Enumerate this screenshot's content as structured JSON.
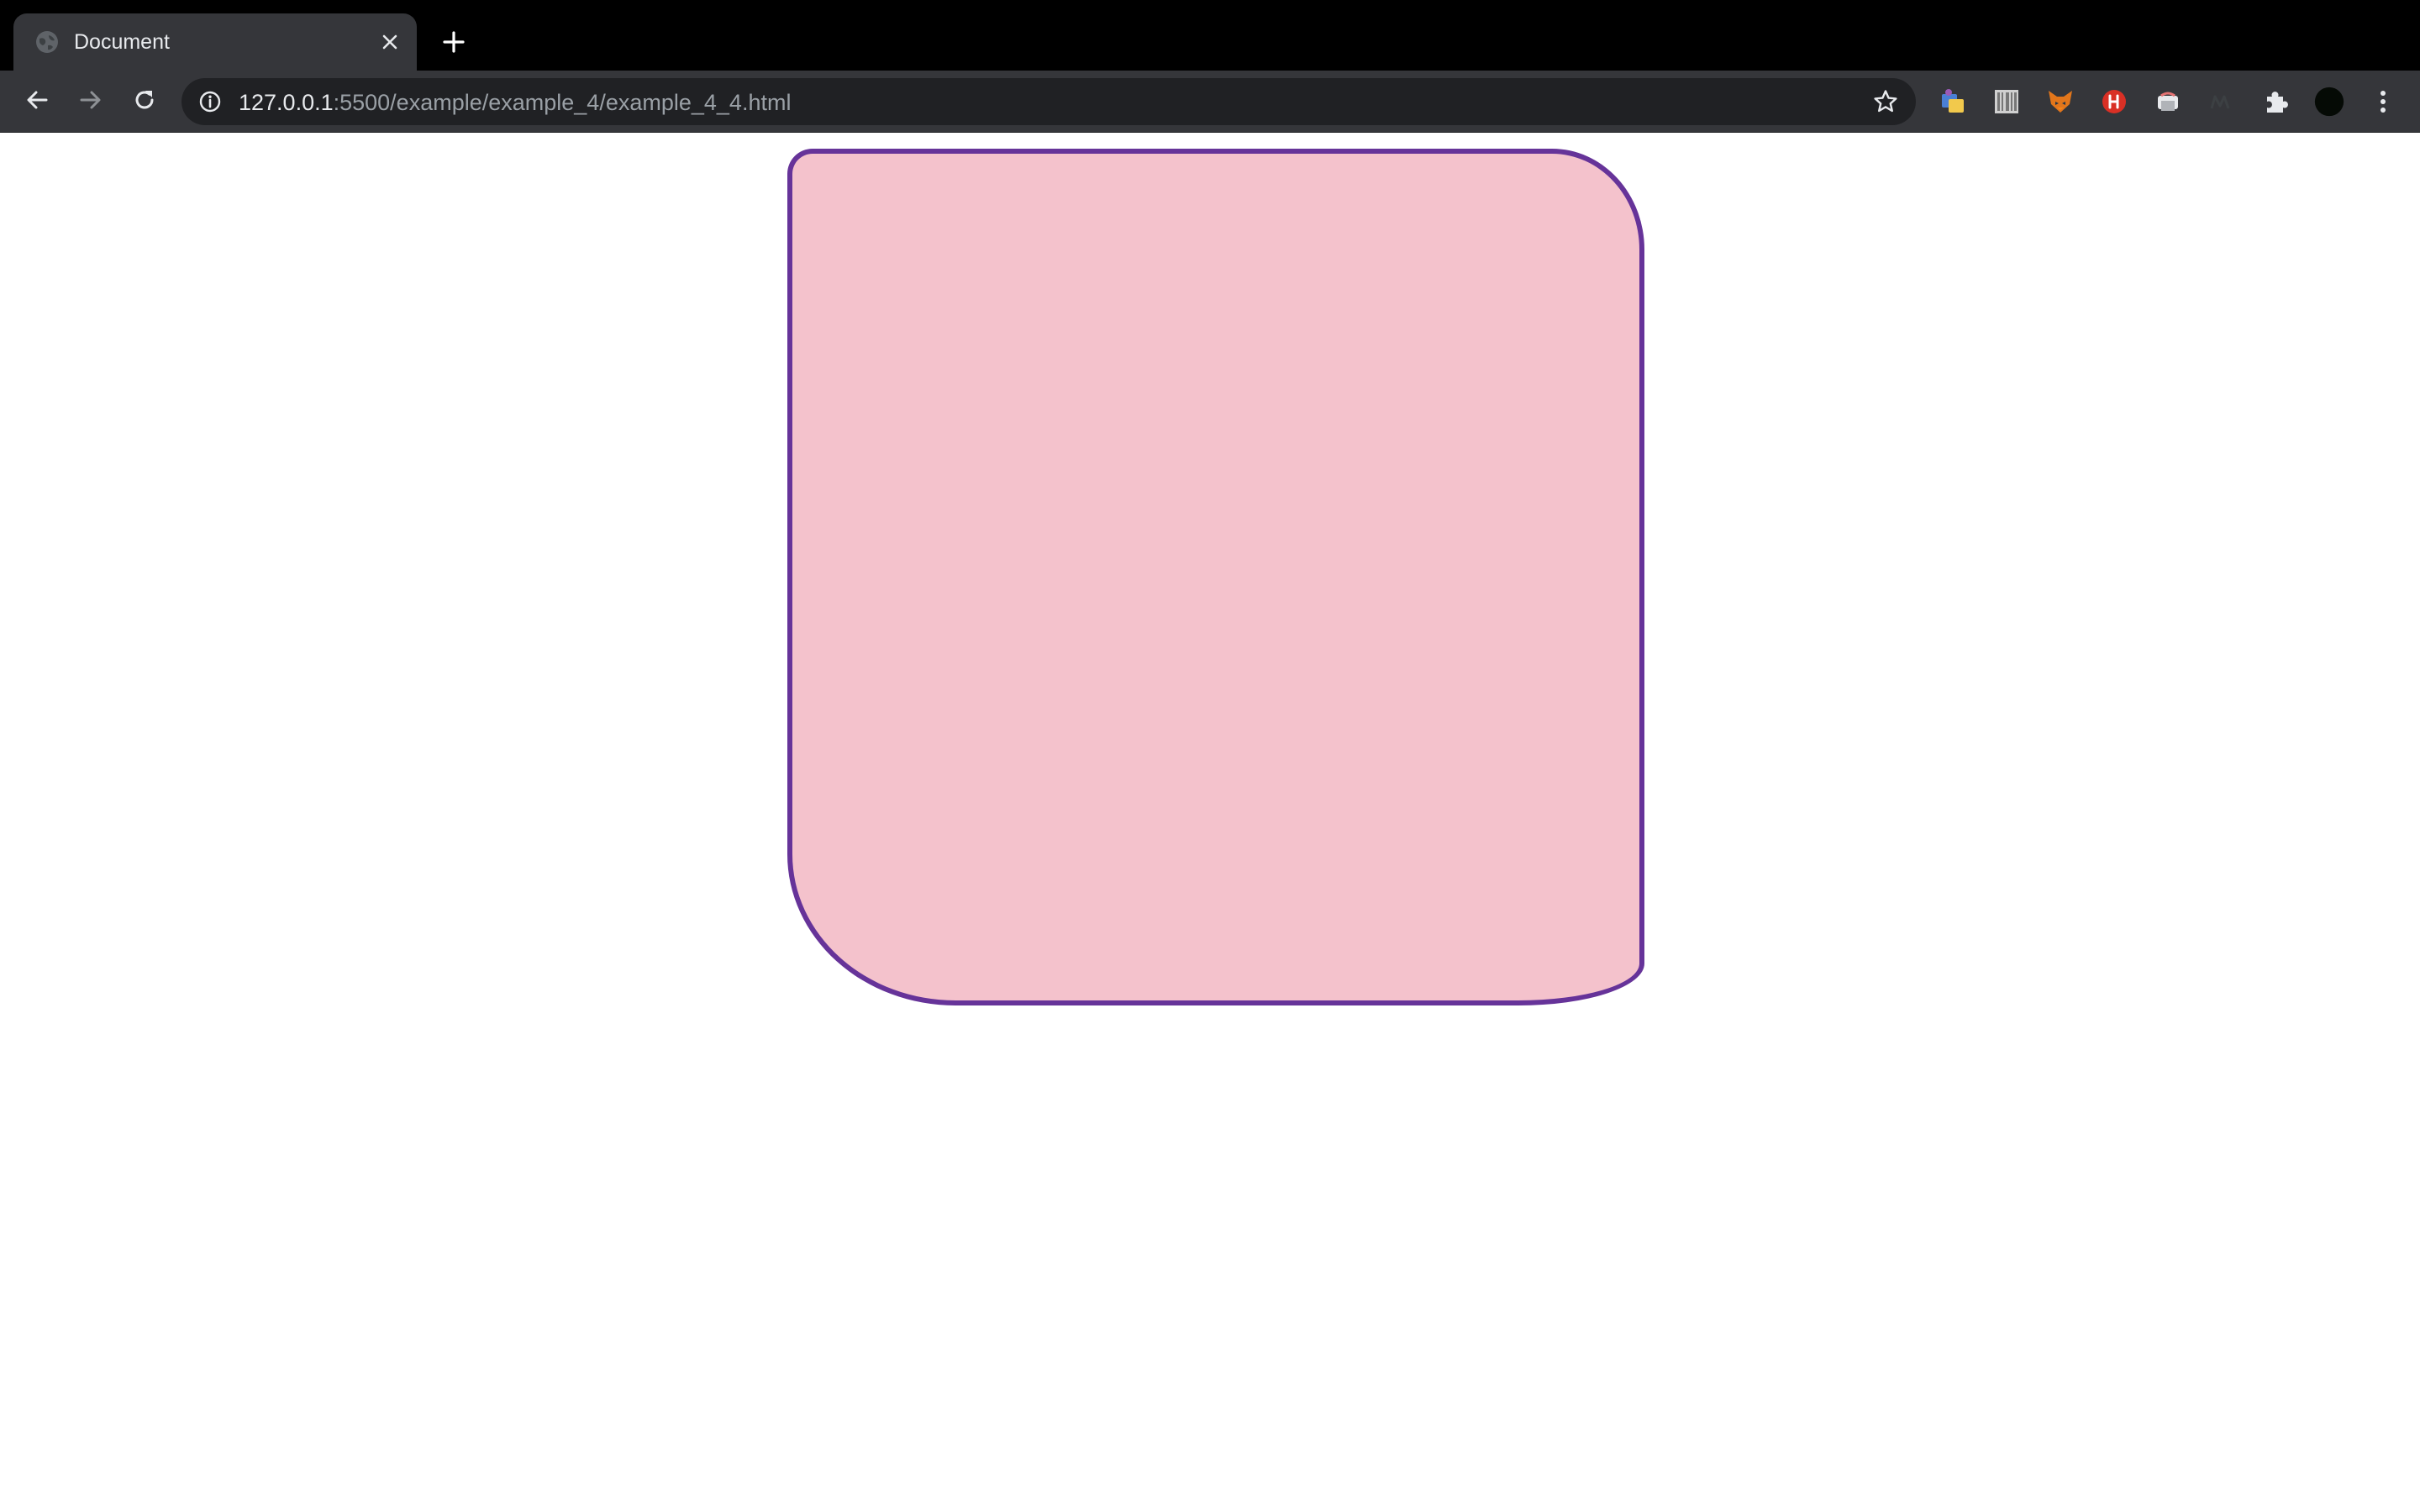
{
  "browser": {
    "tab": {
      "title": "Document"
    },
    "address_bar": {
      "host": "127.0.0.1",
      "path": ":5500/example/example_4/example_4_4.html"
    },
    "icons": {
      "favicon": "globe-icon",
      "close": "close-icon",
      "new_tab": "plus-icon",
      "back": "back-arrow-icon",
      "forward": "forward-arrow-icon",
      "reload": "reload-icon",
      "info": "info-icon",
      "bookmark": "star-icon",
      "extensions": "puzzle-icon",
      "profile": "avatar",
      "menu": "kebab-menu-icon"
    }
  },
  "page": {
    "shape": {
      "fill_color": "#f4c2cc",
      "border_color": "#663399"
    }
  }
}
